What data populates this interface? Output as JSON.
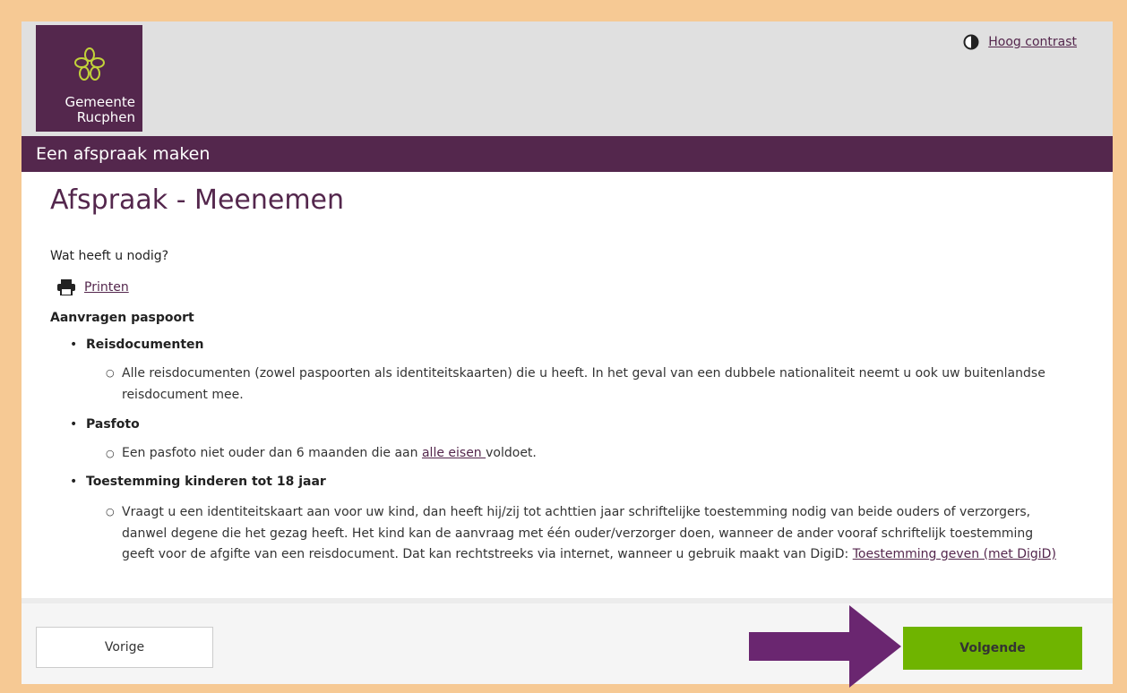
{
  "header": {
    "logo_line1": "Gemeente",
    "logo_line2": "Rucphen",
    "contrast_label": "Hoog contrast"
  },
  "titlebar": {
    "title": "Een afspraak maken"
  },
  "main": {
    "heading": "Afspraak - Meenemen",
    "intro": "Wat heeft u nodig?",
    "print_label": "Printen",
    "requirements_title": "Aanvragen paspoort",
    "items": [
      {
        "title": "Reisdocumenten",
        "lines": [
          "Alle reisdocumenten (zowel paspoorten als identiteitskaarten) die u heeft. In het geval van een dubbele nationaliteit neemt u ook uw buitenlandse",
          "reisdocument mee."
        ]
      },
      {
        "title": "Pasfoto",
        "text_before": "Een pasfoto niet ouder dan 6 maanden die aan ",
        "link": "alle eisen ",
        "text_after": "voldoet."
      },
      {
        "title": "Toestemming kinderen tot 18 jaar",
        "lines": [
          "Vraagt u een identiteitskaart aan voor uw kind, dan heeft hij/zij tot achttien jaar schriftelijke toestemming nodig van beide ouders of verzorgers,",
          "danwel degene die het gezag heeft. Het kind kan de aanvraag met één ouder/verzorger doen, wanneer de ander vooraf schriftelijk toestemming"
        ],
        "last_line_text": "geeft voor de afgifte van een reisdocument. Dat kan rechtstreeks via internet, wanneer u gebruik maakt van DigiD: ",
        "link": "Toestemming geven (met DigiD)"
      }
    ]
  },
  "footer": {
    "prev_label": "Vorige",
    "next_label": "Volgende"
  },
  "colors": {
    "brand": "#54274d",
    "accent_green": "#6fb400",
    "frame": "#f6c994"
  },
  "icons": [
    "flower-logo-icon",
    "contrast-icon",
    "printer-icon",
    "arrow-right-icon"
  ]
}
